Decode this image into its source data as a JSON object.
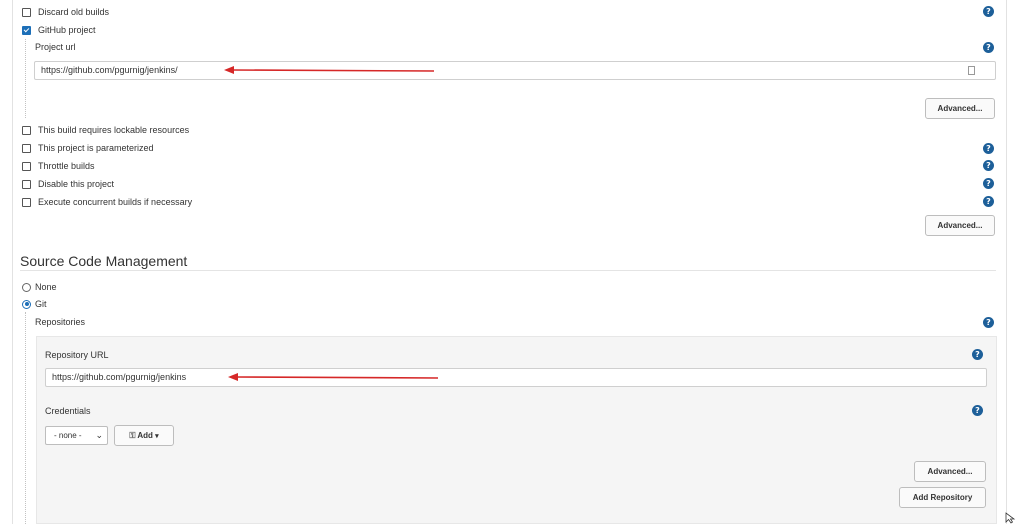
{
  "general": {
    "checkboxes": [
      {
        "label": "Discard old builds",
        "checked": false
      },
      {
        "label": "GitHub project",
        "checked": true
      }
    ],
    "project_url": {
      "label": "Project url",
      "value": "https://github.com/pgurnig/jenkins/"
    },
    "advanced_label": "Advanced...",
    "more_checkboxes": [
      {
        "label": "This build requires lockable resources",
        "checked": false
      },
      {
        "label": "This project is parameterized",
        "checked": false
      },
      {
        "label": "Throttle builds",
        "checked": false
      },
      {
        "label": "Disable this project",
        "checked": false
      },
      {
        "label": "Execute concurrent builds if necessary",
        "checked": false
      }
    ]
  },
  "scm": {
    "title": "Source Code Management",
    "options": [
      {
        "label": "None",
        "selected": false
      },
      {
        "label": "Git",
        "selected": true
      }
    ],
    "repositories_label": "Repositories",
    "repository_url_label": "Repository URL",
    "repository_url_value": "https://github.com/pgurnig/jenkins",
    "credentials_label": "Credentials",
    "credentials_select": "- none -",
    "add_label": "Add",
    "advanced_label": "Advanced...",
    "add_repository_label": "Add Repository"
  },
  "help_glyph": "?",
  "colors": {
    "accent": "#1d6fb8",
    "help": "#1d5f99",
    "arrow": "#d62828"
  }
}
